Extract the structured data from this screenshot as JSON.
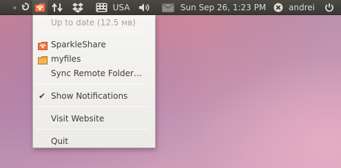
{
  "panel": {
    "keyboard_layout": "USA",
    "clock": "Sun Sep 26,  1:23 PM",
    "user": "andrei",
    "icons": [
      "sync-spiral-icon",
      "sparkleshare-icon",
      "network-transfer-icon",
      "dropbox-icon",
      "keyboard-icon",
      "volume-icon",
      "mail-icon",
      "account-status-icon",
      "power-icon"
    ]
  },
  "menu": {
    "status": "Up to date  (12.5 мв)",
    "items": [
      {
        "label": "SparkleShare",
        "icon": "sparkleshare-folder-icon"
      },
      {
        "label": "myfiles",
        "icon": "folder-icon"
      },
      {
        "label": "Sync Remote Folder…"
      },
      {
        "label": "Show Notifications",
        "checked": true
      },
      {
        "label": "Visit Website"
      },
      {
        "label": "Quit"
      }
    ]
  },
  "colors": {
    "panel_bg": "#3c3b37",
    "panel_text": "#dfdbd2",
    "menu_bg": "#f2f1f0",
    "accent_orange": "#f07746",
    "folder_tan": "#e8a23e",
    "disabled_text": "#a6a39c"
  }
}
